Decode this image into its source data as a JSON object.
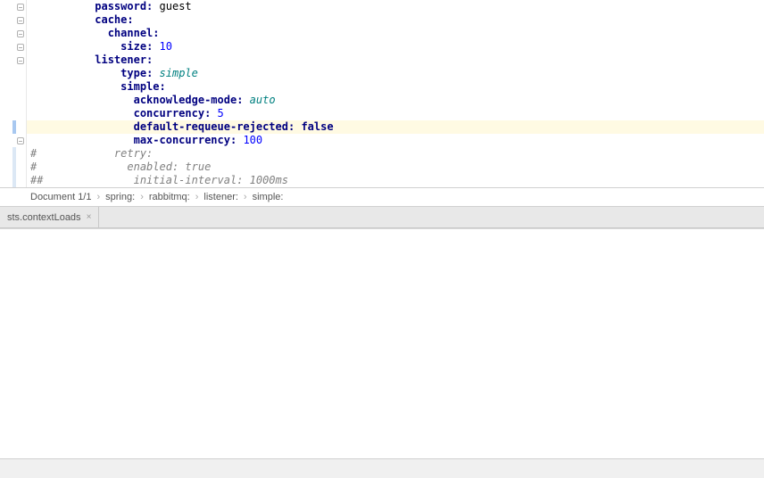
{
  "code": {
    "lines": [
      {
        "indent": 10,
        "key": "password",
        "value": "guest",
        "valueType": "string"
      },
      {
        "indent": 10,
        "key": "cache",
        "value": "",
        "valueType": "none"
      },
      {
        "indent": 12,
        "key": "channel",
        "value": "",
        "valueType": "none"
      },
      {
        "indent": 14,
        "key": "size",
        "value": "10",
        "valueType": "num"
      },
      {
        "indent": 10,
        "key": "listener",
        "value": "",
        "valueType": "none"
      },
      {
        "indent": 14,
        "key": "type",
        "value": "simple",
        "valueType": "keyword"
      },
      {
        "indent": 14,
        "key": "simple",
        "value": "",
        "valueType": "none"
      },
      {
        "indent": 16,
        "key": "acknowledge-mode",
        "value": "auto",
        "valueType": "keyword"
      },
      {
        "indent": 16,
        "key": "concurrency",
        "value": "5",
        "valueType": "num"
      },
      {
        "indent": 16,
        "key": "default-requeue-rejected",
        "value": "false",
        "valueType": "bool",
        "highlighted": true
      },
      {
        "indent": 16,
        "key": "max-concurrency",
        "value": "100",
        "valueType": "num"
      }
    ],
    "comments": [
      {
        "prefix": "#",
        "text": "            retry:"
      },
      {
        "prefix": "#",
        "text": "              enabled: true"
      },
      {
        "prefix": "##",
        "text": "              initial-interval: 1000ms"
      }
    ]
  },
  "breadcrumb": {
    "doc": "Document 1/1",
    "items": [
      "spring:",
      "rabbitmq:",
      "listener:",
      "simple:"
    ]
  },
  "tab": {
    "label": "sts.contextLoads"
  }
}
